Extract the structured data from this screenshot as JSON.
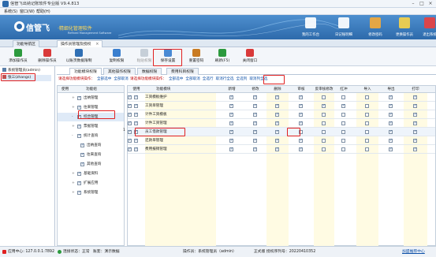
{
  "window": {
    "title": "信管飞出纳记账软件专业版 V9.4.813",
    "controls": [
      "–",
      "□",
      "×"
    ]
  },
  "menu": [
    "系统(S)",
    "窗口(W)",
    "帮助(H)"
  ],
  "banner": {
    "brand": "信管飞",
    "slogan": "·精细化管理软件",
    "tagline": "Refined Management Software",
    "tools": [
      {
        "label": "我的工作台",
        "icon": "monitor-icon"
      },
      {
        "label": "日记账明细",
        "icon": "book-icon"
      },
      {
        "label": "修改密码",
        "icon": "lock-icon"
      },
      {
        "label": "更换操作员",
        "icon": "users-icon"
      },
      {
        "label": "退出系统",
        "icon": "close-icon"
      }
    ]
  },
  "doc_tabs": [
    {
      "label": "功能导航区",
      "active": false
    },
    {
      "label": "操作员管理及授权",
      "active": true
    }
  ],
  "toolbar": [
    {
      "label": "添加操作员",
      "icon": "add-user-icon",
      "enabled": true
    },
    {
      "label": "删除操作员",
      "icon": "delete-user-icon",
      "enabled": true
    },
    {
      "label": "以账页数据限制",
      "icon": "filter-icon",
      "enabled": true
    },
    {
      "label": "复制权限",
      "icon": "copy-icon",
      "enabled": true
    },
    {
      "label": "粘贴权限",
      "icon": "paste-icon",
      "enabled": false
    },
    {
      "label": "保存设置",
      "icon": "save-icon",
      "enabled": true
    },
    {
      "label": "重置密码",
      "icon": "key-icon",
      "enabled": true
    },
    {
      "label": "刷新(F5)",
      "icon": "refresh-icon",
      "enabled": true
    },
    {
      "label": "关闭窗口",
      "icon": "close-window-icon",
      "enabled": true
    }
  ],
  "roles": [
    {
      "label": "系统管理员(admin)",
      "selected": false
    },
    {
      "label": "张三(zhangs)",
      "selected": true
    }
  ],
  "perm_tabs": [
    {
      "label": "功能模块权限",
      "active": true
    },
    {
      "label": "其他操作权限",
      "active": false
    },
    {
      "label": "数据权限",
      "active": false
    },
    {
      "label": "费用科目权限",
      "active": false
    }
  ],
  "hint_left": {
    "prefix": "请选择功能模块操作：",
    "actions": [
      "全部选中",
      "全部取消"
    ]
  },
  "hint_right": {
    "prefix": "请选择功能模块操作：",
    "actions": [
      "全部选中",
      "全部取消",
      "全选行",
      "取消行全选",
      "全选列",
      "取消列全选"
    ]
  },
  "module_table": {
    "headers": [
      "使用",
      "功能组"
    ],
    "rows": [
      {
        "label": "出纳管理",
        "checked": true,
        "level": 1,
        "expand": "+"
      },
      {
        "label": "往来管理",
        "checked": true,
        "level": 1,
        "expand": "+"
      },
      {
        "label": "综合管理",
        "checked": true,
        "level": 1,
        "expand": "-",
        "selected": true
      },
      {
        "label": "票据管理",
        "checked": true,
        "level": 1,
        "expand": "+"
      },
      {
        "label": "统计查询",
        "checked": true,
        "level": 1,
        "expand": "-"
      },
      {
        "label": "出纳查询",
        "checked": true,
        "level": 2,
        "expand": ""
      },
      {
        "label": "往来查询",
        "checked": true,
        "level": 2,
        "expand": ""
      },
      {
        "label": "其他查询",
        "checked": true,
        "level": 2,
        "expand": ""
      },
      {
        "label": "基础资料",
        "checked": true,
        "level": 1,
        "expand": "+"
      },
      {
        "label": "扩展应用",
        "checked": true,
        "level": 1,
        "expand": "+"
      },
      {
        "label": "系统管理",
        "checked": true,
        "level": 1,
        "expand": "+"
      }
    ]
  },
  "perm_table": {
    "headers": [
      "使用",
      "功能模块",
      "新增",
      "修改",
      "删除",
      "审核",
      "反审核修改",
      "红冲",
      "导入",
      "导出",
      "打印"
    ],
    "rows": [
      {
        "name": "工资模板维护",
        "flags": [
          1,
          1,
          1,
          1,
          0,
          0,
          0,
          1,
          1,
          1
        ]
      },
      {
        "name": "工资单管理",
        "flags": [
          1,
          1,
          1,
          1,
          1,
          1,
          0,
          1,
          1,
          1
        ]
      },
      {
        "name": "计件工资模板",
        "flags": [
          1,
          1,
          1,
          1,
          0,
          0,
          0,
          1,
          1,
          1
        ]
      },
      {
        "name": "计件工资管理",
        "flags": [
          1,
          1,
          1,
          1,
          0,
          0,
          0,
          1,
          1,
          1
        ]
      },
      {
        "name": "员工借款管理",
        "flags": [
          1,
          1,
          1,
          0,
          0,
          0,
          0,
          1,
          1,
          1
        ],
        "marker": "1"
      },
      {
        "name": "还款单管理",
        "flags": [
          1,
          1,
          1,
          1,
          0,
          0,
          0,
          1,
          1,
          1
        ]
      },
      {
        "name": "费用报销管理",
        "flags": [
          1,
          1,
          1,
          1,
          0,
          0,
          0,
          1,
          1,
          1
        ]
      }
    ]
  },
  "status": {
    "app_center": "应用中心: 127.0.0.1:7892",
    "link_status": "连接状态：正常",
    "account": "账套：演示数据",
    "operator": "操作员：系统管理员（admin）",
    "edition": "正式版 授权序列号：20220410352",
    "link": "加盟推荐中心"
  },
  "colors": {
    "banner_top": "#4e8fcf",
    "banner_bottom": "#2d6aab",
    "highlight_box": "#e02020",
    "action_link": "#0b4fa8",
    "hint_red": "#c00000"
  }
}
